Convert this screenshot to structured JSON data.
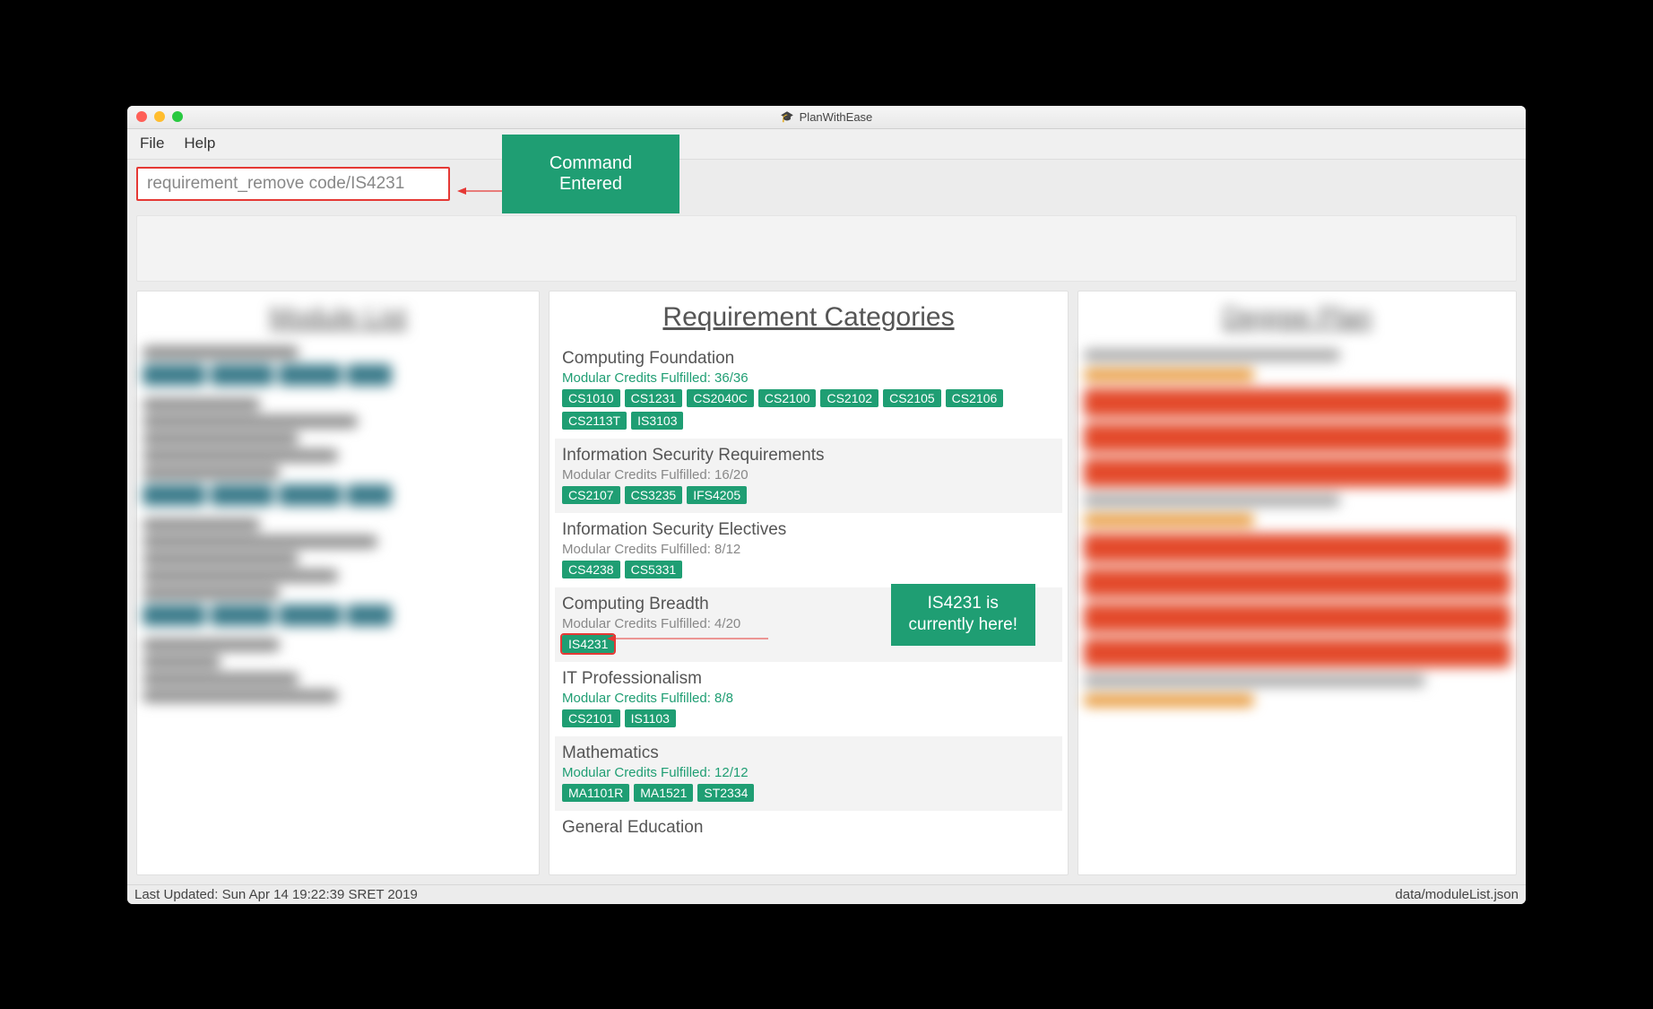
{
  "window": {
    "title": "PlanWithEase"
  },
  "menubar": {
    "file": "File",
    "help": "Help"
  },
  "command": {
    "input_value": "requirement_remove code/IS4231",
    "callout_label": "Command Entered"
  },
  "panels": {
    "left_title": "Module List",
    "mid_title": "Requirement Categories",
    "right_title": "Degree Plan"
  },
  "categories": [
    {
      "title": "Computing Foundation",
      "credits": "Modular Credits Fulfilled: 36/36",
      "credits_color": "green",
      "tags": [
        "CS1010",
        "CS1231",
        "CS2040C",
        "CS2100",
        "CS2102",
        "CS2105",
        "CS2106",
        "CS2113T",
        "IS3103"
      ]
    },
    {
      "title": "Information Security Requirements",
      "credits": "Modular Credits Fulfilled: 16/20",
      "credits_color": "grey",
      "tags": [
        "CS2107",
        "CS3235",
        "IFS4205"
      ]
    },
    {
      "title": "Information Security Electives",
      "credits": "Modular Credits Fulfilled: 8/12",
      "credits_color": "grey",
      "tags": [
        "CS4238",
        "CS5331"
      ]
    },
    {
      "title": "Computing Breadth",
      "credits": "Modular Credits Fulfilled: 4/20",
      "credits_color": "grey",
      "tags": [
        "IS4231"
      ],
      "highlight_tag": "IS4231",
      "callout": "IS4231 is\ncurrently here!"
    },
    {
      "title": "IT Professionalism",
      "credits": "Modular Credits Fulfilled: 8/8",
      "credits_color": "green",
      "tags": [
        "CS2101",
        "IS1103"
      ]
    },
    {
      "title": "Mathematics",
      "credits": "Modular Credits Fulfilled: 12/12",
      "credits_color": "green",
      "tags": [
        "MA1101R",
        "MA1521",
        "ST2334"
      ]
    },
    {
      "title": "General Education",
      "credits": "",
      "credits_color": "grey",
      "tags": []
    }
  ],
  "statusbar": {
    "left": "Last Updated: Sun Apr 14 19:22:39 SRET 2019",
    "right": "data/moduleList.json"
  }
}
